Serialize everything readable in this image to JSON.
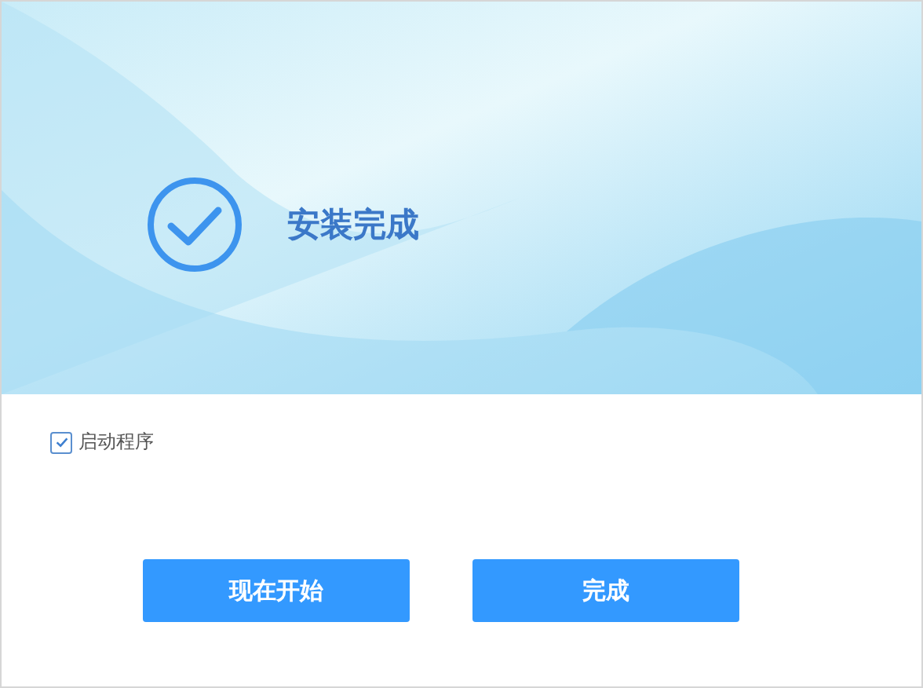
{
  "header": {
    "title": "安装完成"
  },
  "launch_option": {
    "label": "启动程序",
    "checked": true
  },
  "buttons": [
    {
      "label": "现在开始"
    },
    {
      "label": "完成"
    }
  ]
}
